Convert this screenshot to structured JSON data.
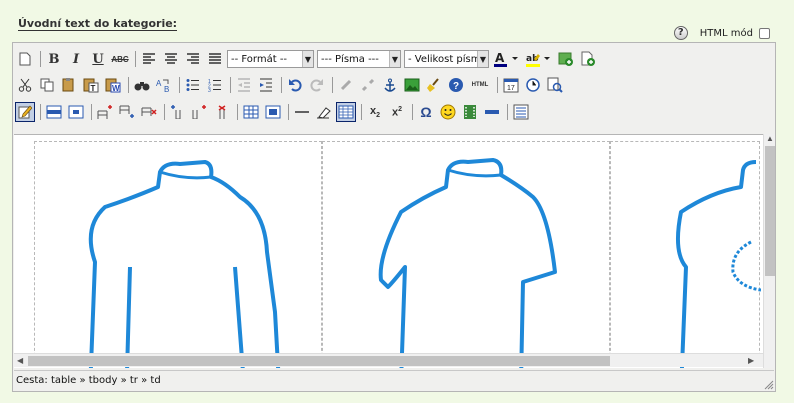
{
  "header": {
    "section_title": "Úvodní text do kategorie:",
    "html_mode_label": "HTML mód",
    "help_symbol": "?"
  },
  "toolbar": {
    "format_select": "-- Formát --",
    "font_select": "--- Písma ---",
    "size_select": "- Velikost písm",
    "bold": "B",
    "italic": "I",
    "underline": "U",
    "strike": "ABC",
    "html_label": "HTML",
    "sub": "x",
    "sup": "x",
    "omega": "Ω"
  },
  "status": {
    "path_label": "Cesta:",
    "path": "table » tbody » tr » td"
  },
  "colors": {
    "page_bg": "#f1f9e5",
    "shirt_outline": "#1e88d8",
    "editor_bg": "#f0f0ee"
  }
}
